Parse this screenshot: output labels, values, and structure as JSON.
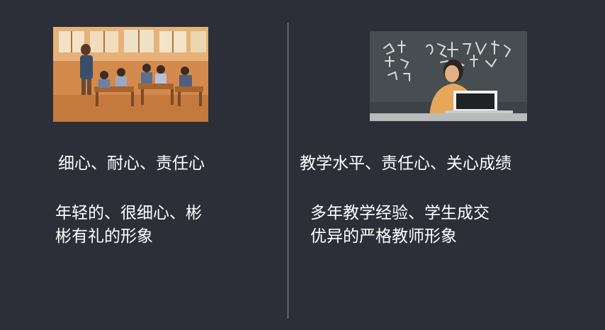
{
  "left": {
    "heading": "细心、耐心、责任心",
    "description_lines": [
      "年轻的、很细心、彬",
      "彬有礼的形象"
    ]
  },
  "right": {
    "heading": "教学水平、责任心、关心成绩",
    "description_lines": [
      "多年教学经验、学生成交",
      "优异的严格教师形象"
    ]
  },
  "colors": {
    "background": "#2c2f37",
    "divider": "#8f939c",
    "text": "#ffffff"
  }
}
